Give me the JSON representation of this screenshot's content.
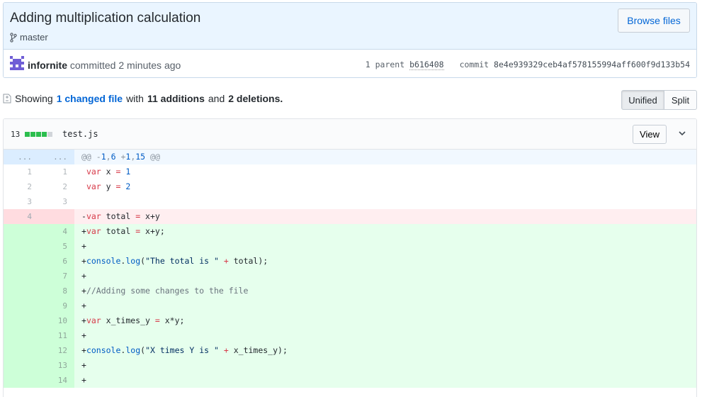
{
  "commit": {
    "title": "Adding multiplication calculation",
    "branch": "master",
    "browse_label": "Browse files",
    "author": "infornite",
    "committed_text": "committed 2 minutes ago",
    "parent_label": "1 parent",
    "parent_sha": "b616408",
    "commit_label": "commit",
    "commit_sha": "8e4e939329ceb4af578155994aff600f9d133b54"
  },
  "toc": {
    "showing": "Showing",
    "changed_link": "1 changed file",
    "with": "with",
    "additions": "11 additions",
    "and": "and",
    "deletions": "2 deletions.",
    "unified_label": "Unified",
    "split_label": "Split"
  },
  "file": {
    "changes": "13",
    "name": "test.js",
    "view_label": "View",
    "colors": {
      "added": "#2cbe4e",
      "neutral": "#d1d5da"
    }
  },
  "diff": {
    "hunk": {
      "left": "...",
      "right": "...",
      "text": "@@ -1,6 +1,15 @@"
    },
    "lines": [
      {
        "type": "ctx",
        "old": "1",
        "new": "1",
        "text": " var x = 1"
      },
      {
        "type": "ctx",
        "old": "2",
        "new": "2",
        "text": " var y = 2"
      },
      {
        "type": "ctx",
        "old": "3",
        "new": "3",
        "text": ""
      },
      {
        "type": "del",
        "old": "4",
        "new": "",
        "text": "-var total = x+y"
      },
      {
        "type": "add",
        "old": "",
        "new": "4",
        "text": "+var total = x+y;"
      },
      {
        "type": "add",
        "old": "",
        "new": "5",
        "text": "+"
      },
      {
        "type": "add",
        "old": "",
        "new": "6",
        "text": "+console.log(\"The total is \" + total);"
      },
      {
        "type": "add",
        "old": "",
        "new": "7",
        "text": "+"
      },
      {
        "type": "add",
        "old": "",
        "new": "8",
        "text": "+//Adding some changes to the file"
      },
      {
        "type": "add",
        "old": "",
        "new": "9",
        "text": "+"
      },
      {
        "type": "add",
        "old": "",
        "new": "10",
        "text": "+var x_times_y = x*y;"
      },
      {
        "type": "add",
        "old": "",
        "new": "11",
        "text": "+"
      },
      {
        "type": "add",
        "old": "",
        "new": "12",
        "text": "+console.log(\"X times Y is \" + x_times_y);"
      },
      {
        "type": "add",
        "old": "",
        "new": "13",
        "text": "+"
      },
      {
        "type": "add",
        "old": "",
        "new": "14",
        "text": "+"
      }
    ]
  }
}
